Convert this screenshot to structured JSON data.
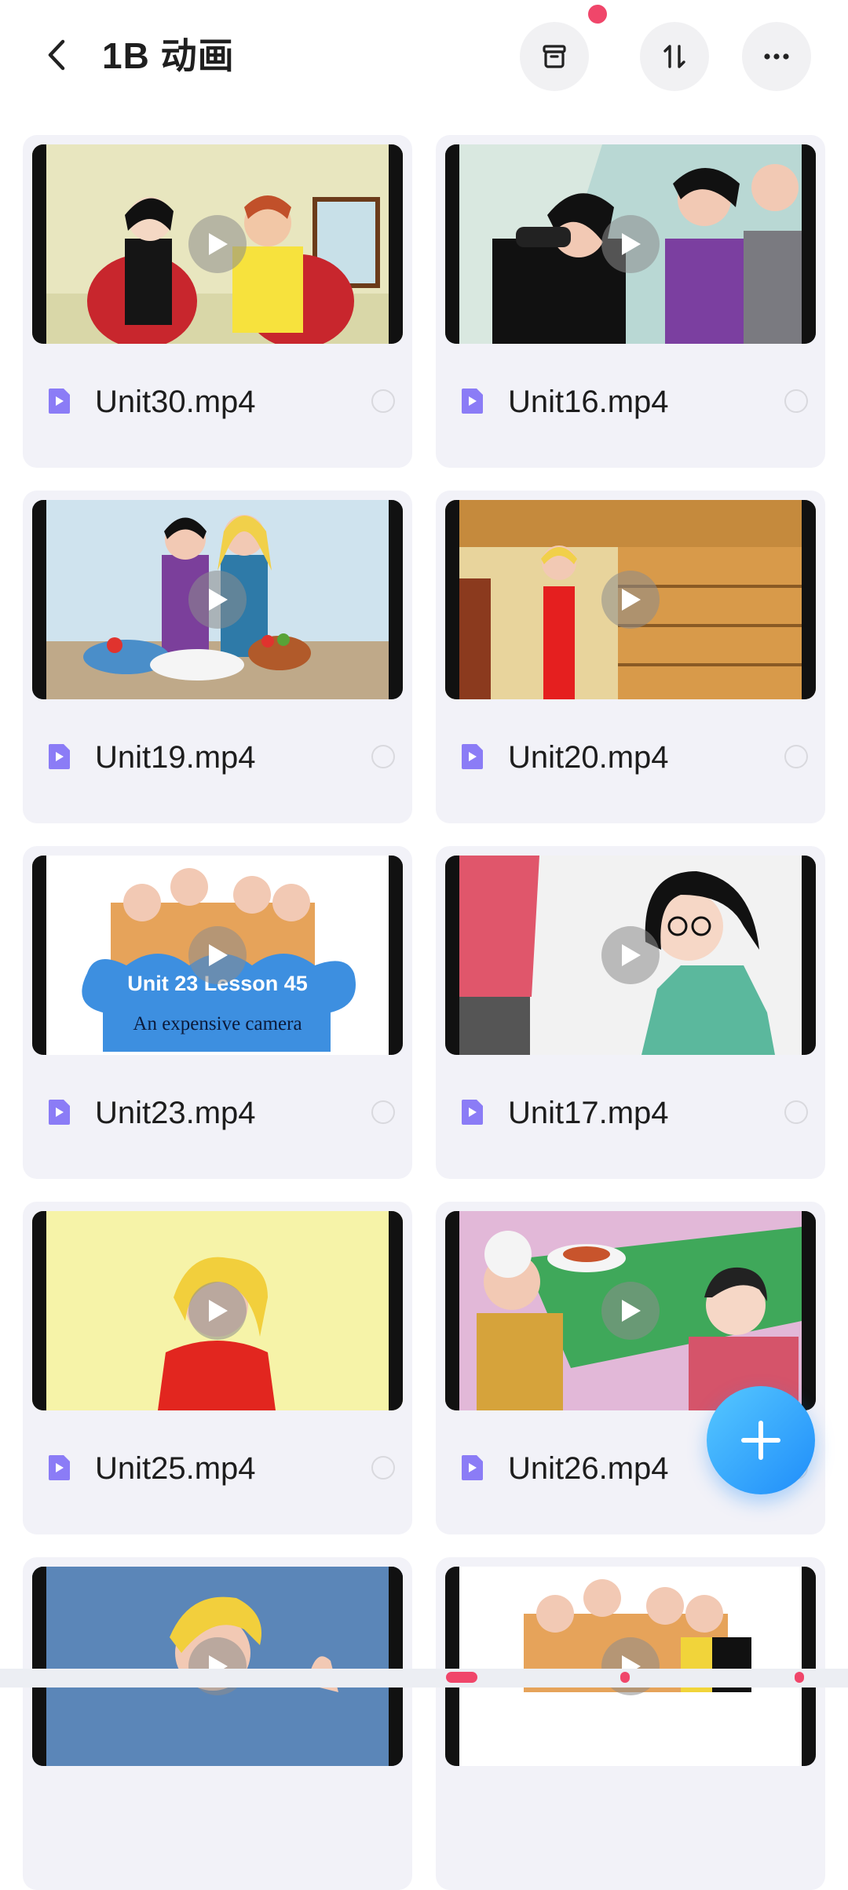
{
  "header": {
    "title": "1B 动画"
  },
  "icons": {
    "back": "back-icon",
    "archive": "archive-icon",
    "sort": "sort-icon",
    "more": "more-icon",
    "play": "play-icon",
    "video_file": "video-file-icon",
    "add": "plus-icon"
  },
  "colors": {
    "accent": "#1f8dfa",
    "badge": "#f0466a",
    "file_icon": "#8b7cf6",
    "card_bg": "#f2f2f8"
  },
  "files": [
    {
      "name": "Unit30.mp4"
    },
    {
      "name": "Unit16.mp4"
    },
    {
      "name": "Unit19.mp4"
    },
    {
      "name": "Unit20.mp4"
    },
    {
      "name": "Unit23.mp4",
      "thumb_text_1": "Unit 23 Lesson 45",
      "thumb_text_2": "An expensive camera"
    },
    {
      "name": "Unit17.mp4"
    },
    {
      "name": "Unit25.mp4"
    },
    {
      "name": "Unit26.mp4"
    },
    {
      "name": ""
    },
    {
      "name": ""
    }
  ]
}
